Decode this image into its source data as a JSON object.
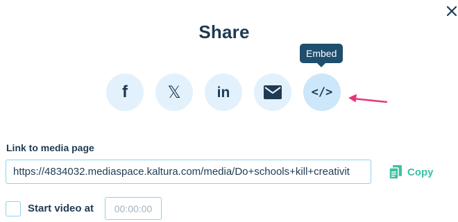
{
  "dialog": {
    "title": "Share",
    "close_icon": "close-icon"
  },
  "share_buttons": [
    {
      "id": "facebook",
      "icon": "facebook-icon",
      "glyph": "f"
    },
    {
      "id": "x",
      "icon": "x-icon",
      "glyph": "𝕏"
    },
    {
      "id": "linkedin",
      "icon": "linkedin-icon",
      "glyph": "in"
    },
    {
      "id": "email",
      "icon": "envelope-icon",
      "glyph": ""
    },
    {
      "id": "embed",
      "icon": "embed-code-icon",
      "glyph": "</>",
      "active": true
    }
  ],
  "tooltip": {
    "text": "Embed"
  },
  "annotation": {
    "icon": "arrow-left-icon",
    "color": "#e8357a"
  },
  "link": {
    "label": "Link to media page",
    "value": "https://4834032.mediaspace.kaltura.com/media/Do+schools+kill+creativit",
    "copy_label": "Copy",
    "copy_icon": "copy-icon"
  },
  "start_video": {
    "label": "Start video at",
    "checked": false,
    "time_placeholder": "00:00:00"
  },
  "colors": {
    "primary_text": "#1f3a52",
    "button_bg": "#e2f1fb",
    "tooltip_bg": "#1f4e6e",
    "accent_green": "#3cc1a4",
    "input_border": "#8fd1ec"
  }
}
